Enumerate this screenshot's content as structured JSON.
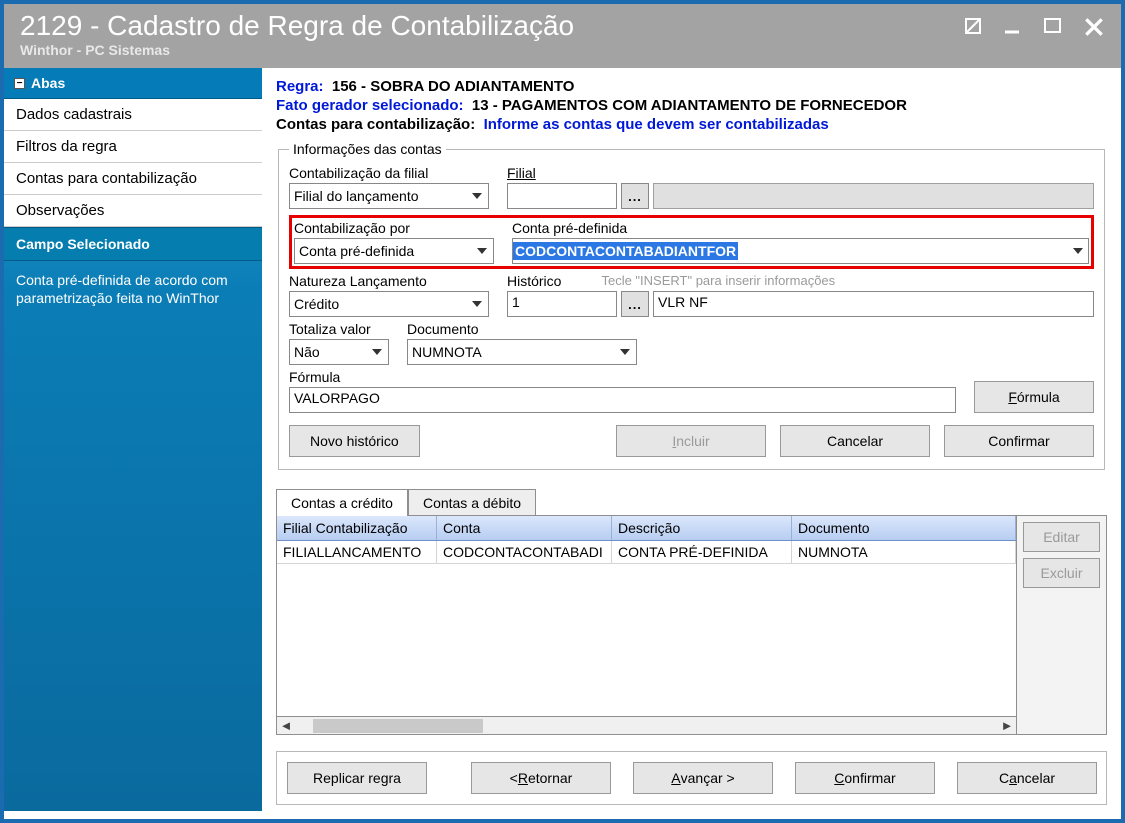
{
  "titlebar": {
    "title": "2129 - Cadastro de Regra de Contabilização",
    "subtitle": "Winthor - PC Sistemas"
  },
  "sidebar": {
    "header": "Abas",
    "items": [
      "Dados cadastrais",
      "Filtros da regra",
      "Contas para contabilização",
      "Observações"
    ],
    "campo_header": "Campo Selecionado",
    "campo_desc": "Conta pré-definida de acordo com parametrização feita no WinThor"
  },
  "header_info": {
    "regra_lbl": "Regra:",
    "regra_val": "156 - SOBRA DO ADIANTAMENTO",
    "fato_lbl": "Fato gerador selecionado:",
    "fato_val": "13 - PAGAMENTOS COM ADIANTAMENTO DE FORNECEDOR",
    "contas_lbl": "Contas para contabilização:",
    "contas_val": "Informe as contas que devem ser contabilizadas"
  },
  "group": {
    "legend": "Informações das contas",
    "contab_filial_lbl": "Contabilização da filial",
    "contab_filial_val": "Filial do lançamento",
    "filial_lbl": "Filial",
    "contab_por_lbl": "Contabilização por",
    "contab_por_val": "Conta pré-definida",
    "conta_predef_lbl": "Conta pré-definida",
    "conta_predef_val": "CODCONTACONTABADIANTFOR",
    "natureza_lbl": "Natureza Lançamento",
    "natureza_val": "Crédito",
    "historico_lbl": "Histórico",
    "historico_val": "1",
    "historico_hint": "Tecle \"INSERT\" para inserir informações",
    "historico_desc": "VLR NF",
    "totaliza_lbl": "Totaliza valor",
    "totaliza_val": "Não",
    "documento_lbl": "Documento",
    "documento_val": "NUMNOTA",
    "formula_lbl": "Fórmula",
    "formula_val": "VALORPAGO",
    "formula_btn": "Fórmula",
    "novo_btn": "Novo histórico",
    "incluir_btn": "Incluir",
    "cancelar_btn": "Cancelar",
    "confirmar_btn": "Confirmar"
  },
  "tabs": {
    "credito": "Contas a crédito",
    "debito": "Contas a débito"
  },
  "grid": {
    "headers": [
      "Filial Contabilização",
      "Conta",
      "Descrição",
      "Documento"
    ],
    "row": [
      "FILIALLANCAMENTO",
      "CODCONTACONTABADI",
      "CONTA PRÉ-DEFINIDA",
      "NUMNOTA"
    ],
    "editar": "Editar",
    "excluir": "Excluir"
  },
  "bottom": {
    "replicar": "Replicar regra",
    "retornar": "< Retornar",
    "avancar": "Avançar >",
    "confirmar": "Confirmar",
    "cancelar": "Cancelar"
  }
}
